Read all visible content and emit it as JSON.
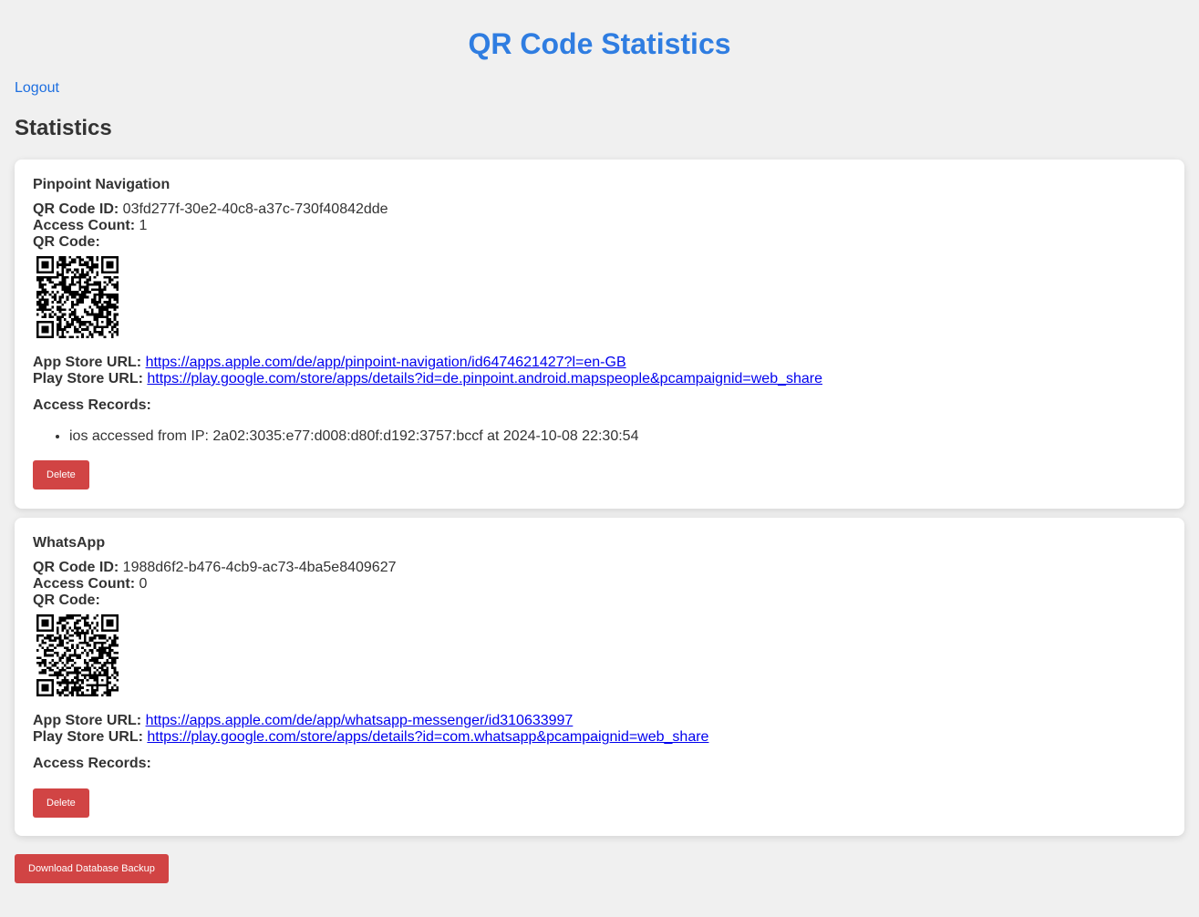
{
  "header": {
    "title": "QR Code Statistics",
    "logout_label": "Logout"
  },
  "section": {
    "heading": "Statistics"
  },
  "labels": {
    "qr_code_id": "QR Code ID:",
    "access_count": "Access Count:",
    "qr_code": "QR Code:",
    "app_store_url": "App Store URL:",
    "play_store_url": "Play Store URL:",
    "access_records": "Access Records:",
    "delete": "Delete"
  },
  "entries": [
    {
      "name": "Pinpoint Navigation",
      "qr_code_id": "03fd277f-30e2-40c8-a37c-730f40842dde",
      "access_count": "1",
      "app_store_url": "https://apps.apple.com/de/app/pinpoint-navigation/id6474621427?l=en-GB",
      "play_store_url": "https://play.google.com/store/apps/details?id=de.pinpoint.android.mapspeople&pcampaignid=web_share",
      "access_records": [
        "ios accessed from IP: 2a02:3035:e77:d008:d80f:d192:3757:bccf at 2024-10-08 22:30:54"
      ]
    },
    {
      "name": "WhatsApp",
      "qr_code_id": "1988d6f2-b476-4cb9-ac73-4ba5e8409627",
      "access_count": "0",
      "app_store_url": "https://apps.apple.com/de/app/whatsapp-messenger/id310633997",
      "play_store_url": "https://play.google.com/store/apps/details?id=com.whatsapp&pcampaignid=web_share",
      "access_records": []
    }
  ],
  "footer": {
    "backup_label": "Download Database Backup"
  },
  "colors": {
    "title": "#2f7de1",
    "link": "#0000ee",
    "button": "#d14444",
    "background": "#f0f0f0"
  }
}
